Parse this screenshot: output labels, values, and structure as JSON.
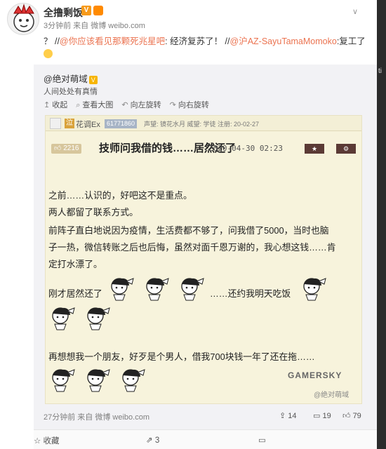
{
  "post": {
    "author": "全撸剩饭",
    "meta": "3分钟前 来自 微博 weibo.com",
    "reply_prefix": "？ //",
    "mention1": "@你应该看见那颗死兆星吧",
    "reply_mid": ": 经济复苏了！ //",
    "mention2": "@沪AZ-SayuTamaMomoko",
    "reply_end": ":复工了"
  },
  "forward": {
    "author": "@绝对萌域",
    "text": "人间处处有真情",
    "tools": [
      "收起",
      "查看大图",
      "向左旋转",
      "向右旋转"
    ],
    "time": "27分钟前 来自 微博 weibo.com",
    "repost_count": "14",
    "comment_count": "19",
    "like_count": "79",
    "actions": [
      "收藏",
      "3"
    ]
  },
  "screenshot": {
    "tag": "泣",
    "site": "花调Ex",
    "uid": "61771860",
    "rep": "声望: 镜花水月 威望: 学徒 注册: 20-02-27",
    "likes": "2216",
    "title": "技师问我借的钱……居然还了",
    "time": "2020-04-30 02:23",
    "btn1": "★",
    "btn2": "⚙",
    "lines": [
      "之前……认识的，好吧这不是重点。",
      "两人都留了联系方式。",
      "前阵子直白地说因为疫情，生活费都不够了，问我借了5000，当时也脑",
      "子一热，微信转账之后也后悔，虽然对面千恩万谢的，我心想这钱……肯",
      "定打水漂了。"
    ],
    "line_then": "刚才居然还了",
    "line_then2": "……还约我明天吃饭",
    "line_last": "再想想我一个朋友，好歹是个男人，借我700块钱一年了还在拖……",
    "watermark": "@绝对萌域"
  },
  "watermark": "GAMERSKY",
  "right_tab": "ti"
}
